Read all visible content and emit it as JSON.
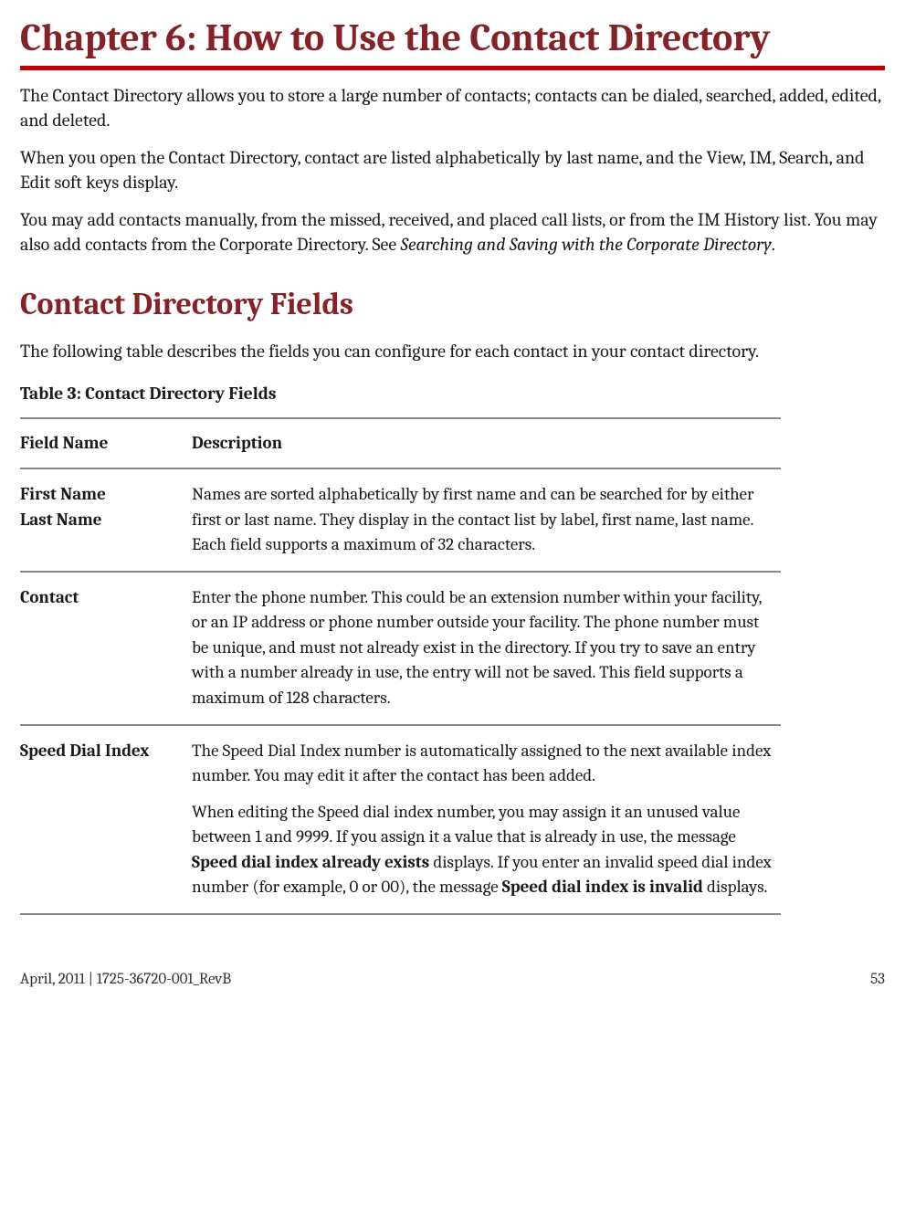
{
  "chapter_title": "Chapter 6: How to Use the Contact Directory",
  "intro": {
    "p1": "The Contact Directory allows you to store a large number of contacts; contacts can be dialed, searched, added, edited, and deleted.",
    "p2": "When you open the Contact Directory, contact are listed alphabetically by last name, and the View, IM, Search, and Edit soft keys display.",
    "p3_a": "You may add contacts manually, from the missed, received, and placed call lists, or from the IM History list. You may also add contacts from the Corporate Directory. See ",
    "p3_i": "Searching and Saving with the Corporate Directory",
    "p3_b": "."
  },
  "section_title": "Contact Directory Fields",
  "section_intro": "The following table describes the fields you can configure for each contact in your contact directory.",
  "table_caption": "Table 3: Contact Directory Fields",
  "table": {
    "headers": {
      "field": "Field Name",
      "desc": "Description"
    },
    "rows": [
      {
        "field_a": "First Name",
        "field_b": "Last Name",
        "desc": "Names are sorted alphabetically by first name and can be searched for by either first or last name. They display in the contact list by label, first name, last name. Each field supports a maximum of 32 characters."
      },
      {
        "field_a": "Contact",
        "desc": "Enter the phone number. This could be an extension number within your facility, or an IP address or phone number outside your facility. The phone number must be unique, and must not already exist in the directory. If you try to save an entry with a number already in use, the entry will not be saved. This field supports a maximum of 128 characters."
      },
      {
        "field_a": "Speed Dial Index",
        "desc_p1": "The Speed Dial Index number is automatically assigned to the next available index number. You may edit it after the contact has been added.",
        "desc_p2_a": "When editing the Speed dial index number, you may assign it an unused value between 1 and 9999. If you assign it a value that is already in use, the message ",
        "desc_p2_b": "Speed dial index already exists",
        "desc_p2_c": " displays. If you enter an invalid speed dial index number (for example, 0 or 00), the message ",
        "desc_p2_d": "Speed dial index is invalid",
        "desc_p2_e": " displays."
      }
    ]
  },
  "footer": {
    "left": "April, 2011  |  1725-36720-001_RevB",
    "right": "53"
  }
}
